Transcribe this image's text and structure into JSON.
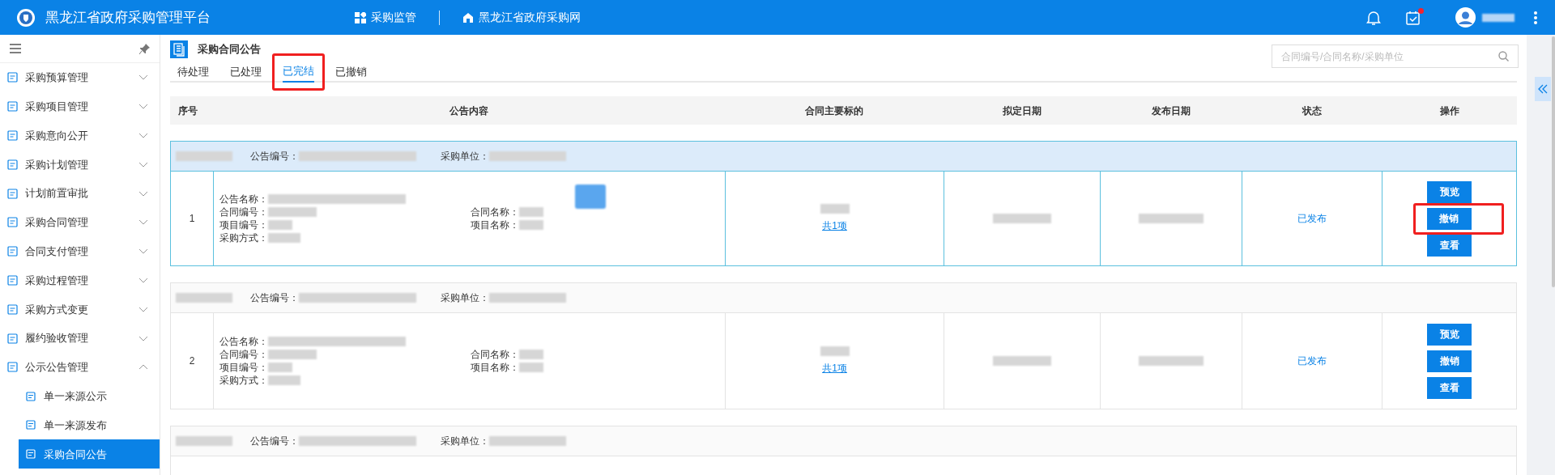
{
  "header": {
    "title": "黑龙江省政府采购管理平台",
    "nav": [
      {
        "label": "采购监管",
        "kind": "grid"
      },
      {
        "label": "黑龙江省政府采购网",
        "kind": "home"
      }
    ],
    "notification_dot": true
  },
  "sidebar": {
    "items": [
      {
        "label": "采购预算管理",
        "expanded": false
      },
      {
        "label": "采购项目管理",
        "expanded": false
      },
      {
        "label": "采购意向公开",
        "expanded": false
      },
      {
        "label": "采购计划管理",
        "expanded": false
      },
      {
        "label": "计划前置审批",
        "expanded": false
      },
      {
        "label": "采购合同管理",
        "expanded": false
      },
      {
        "label": "合同支付管理",
        "expanded": false
      },
      {
        "label": "采购过程管理",
        "expanded": false
      },
      {
        "label": "采购方式变更",
        "expanded": false
      },
      {
        "label": "履约验收管理",
        "expanded": false
      },
      {
        "label": "公示公告管理",
        "expanded": true,
        "children": [
          {
            "label": "单一来源公示",
            "selected": false
          },
          {
            "label": "单一来源发布",
            "selected": false
          },
          {
            "label": "采购合同公告",
            "selected": true
          }
        ]
      }
    ]
  },
  "page": {
    "title": "采购合同公告",
    "tabs": [
      {
        "label": "待处理",
        "selected": false,
        "highlighted": false
      },
      {
        "label": "已处理",
        "selected": false,
        "highlighted": false
      },
      {
        "label": "已完结",
        "selected": true,
        "highlighted": true
      },
      {
        "label": "已撤销",
        "selected": false,
        "highlighted": false
      }
    ],
    "search": {
      "placeholder": "合同编号/合同名称/采购单位"
    }
  },
  "table": {
    "columns": [
      "序号",
      "公告内容",
      "合同主要标的",
      "拟定日期",
      "发布日期",
      "状态",
      "操作"
    ],
    "groups": [
      {
        "selected": true,
        "header_labels": [
          "公告编号：",
          "采购单位："
        ],
        "row": {
          "index": "1",
          "fields": [
            "公告名称：",
            "合同编号：",
            "合同名称：",
            "项目编号：",
            "项目名称：",
            "采购方式："
          ],
          "subject_link": "共1项",
          "status": "已发布",
          "actions": [
            {
              "label": "预览",
              "highlighted": false
            },
            {
              "label": "撤销",
              "highlighted": true
            },
            {
              "label": "查看",
              "highlighted": false
            }
          ]
        }
      },
      {
        "selected": false,
        "header_labels": [
          "公告编号：",
          "采购单位："
        ],
        "row": {
          "index": "2",
          "fields": [
            "公告名称：",
            "合同编号：",
            "合同名称：",
            "项目编号：",
            "项目名称：",
            "采购方式："
          ],
          "subject_link": "共1项",
          "status": "已发布",
          "actions": [
            {
              "label": "预览",
              "highlighted": false
            },
            {
              "label": "撤销",
              "highlighted": false
            },
            {
              "label": "查看",
              "highlighted": false
            }
          ]
        }
      },
      {
        "selected": false,
        "header_labels": [
          "公告编号：",
          "采购单位："
        ]
      }
    ]
  }
}
